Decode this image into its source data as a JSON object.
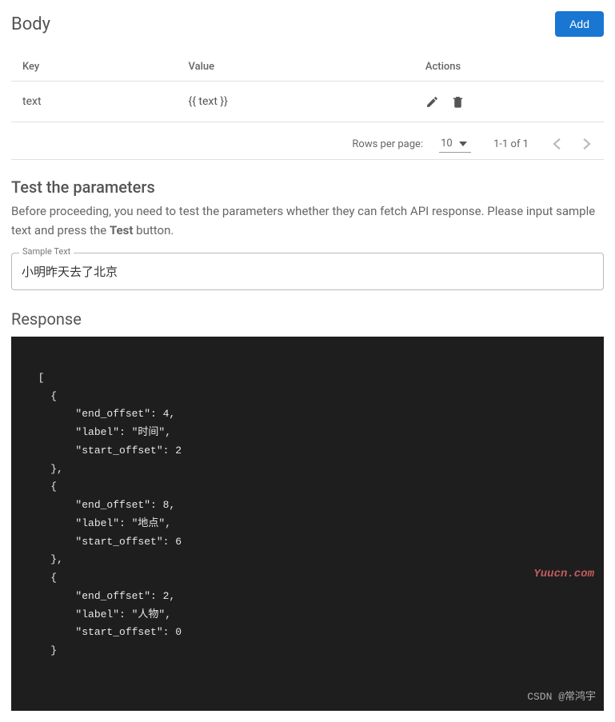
{
  "body_section": {
    "title": "Body",
    "add_label": "Add"
  },
  "table": {
    "headers": {
      "key": "Key",
      "value": "Value",
      "actions": "Actions"
    },
    "rows": [
      {
        "key": "text",
        "value": "{{ text }}"
      }
    ]
  },
  "pagination": {
    "rows_label": "Rows per page:",
    "rows_value": "10",
    "range_text": "1-1 of 1"
  },
  "test_section": {
    "title": "Test the parameters",
    "description_before": "Before proceeding, you need to test the parameters whether they can fetch API response. Please input sample text and press the ",
    "description_bold": "Test",
    "description_after": " button."
  },
  "sample_input": {
    "label": "Sample Text",
    "value": "小明昨天去了北京"
  },
  "response": {
    "title": "Response",
    "content": "[\n    {\n        \"end_offset\": 4,\n        \"label\": \"时间\",\n        \"start_offset\": 2\n    },\n    {\n        \"end_offset\": 8,\n        \"label\": \"地点\",\n        \"start_offset\": 6\n    },\n    {\n        \"end_offset\": 2,\n        \"label\": \"人物\",\n        \"start_offset\": 0\n    }"
  },
  "watermarks": {
    "top": "Yuucn.com",
    "bottom": "CSDN @常鸿宇"
  }
}
